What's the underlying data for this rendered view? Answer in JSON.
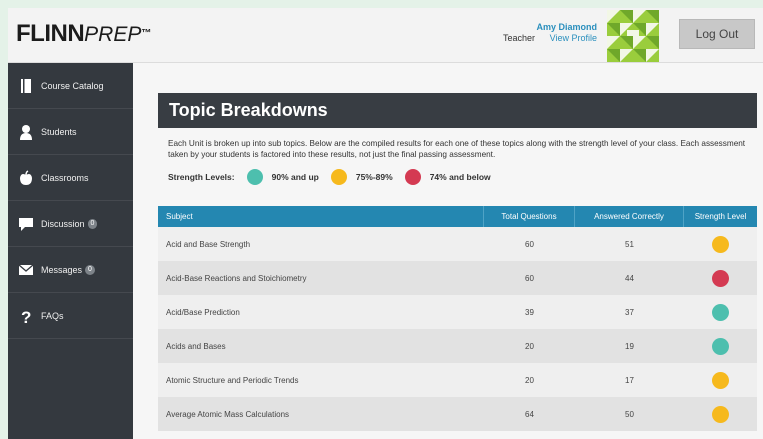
{
  "colors": {
    "green": "#4dbfae",
    "yellow": "#f6b91d",
    "red": "#d43a52",
    "header_blue": "#2487b1"
  },
  "header": {
    "logo_part1": "FLINN",
    "logo_part2": "PREP",
    "logo_tm": "™",
    "user_name": "Amy Diamond",
    "user_role": "Teacher",
    "view_profile": "View Profile",
    "logout": "Log Out"
  },
  "sidebar": {
    "items": [
      {
        "label": "Course Catalog",
        "icon": "book-icon"
      },
      {
        "label": "Students",
        "icon": "person-icon"
      },
      {
        "label": "Classrooms",
        "icon": "apple-icon"
      },
      {
        "label": "Discussion",
        "icon": "chat-icon",
        "badge": "0"
      },
      {
        "label": "Messages",
        "icon": "envelope-icon",
        "badge": "0"
      },
      {
        "label": "FAQs",
        "icon": "question-icon"
      }
    ]
  },
  "main": {
    "title": "Topic Breakdowns",
    "intro": "Each Unit is broken up into sub topics. Below are the compiled results for each one of these topics along with the strength level of your class. Each assessment taken by your students is factored into these results, not just the final passing assessment.",
    "levels_label": "Strength Levels:",
    "levels": [
      {
        "label": "90% and up",
        "color": "green"
      },
      {
        "label": "75%-89%",
        "color": "yellow"
      },
      {
        "label": "74% and below",
        "color": "red"
      }
    ]
  },
  "table": {
    "columns": [
      "Subject",
      "Total Questions",
      "Answered Correctly",
      "Strength Level"
    ],
    "rows": [
      {
        "subject": "Acid and Base Strength",
        "total": "60",
        "correct": "51",
        "level": "yellow"
      },
      {
        "subject": "Acid-Base Reactions and Stoichiometry",
        "total": "60",
        "correct": "44",
        "level": "red"
      },
      {
        "subject": "Acid/Base Prediction",
        "total": "39",
        "correct": "37",
        "level": "green"
      },
      {
        "subject": "Acids and Bases",
        "total": "20",
        "correct": "19",
        "level": "green"
      },
      {
        "subject": "Atomic Structure and Periodic Trends",
        "total": "20",
        "correct": "17",
        "level": "yellow"
      },
      {
        "subject": "Average Atomic Mass Calculations",
        "total": "64",
        "correct": "50",
        "level": "yellow"
      }
    ]
  }
}
